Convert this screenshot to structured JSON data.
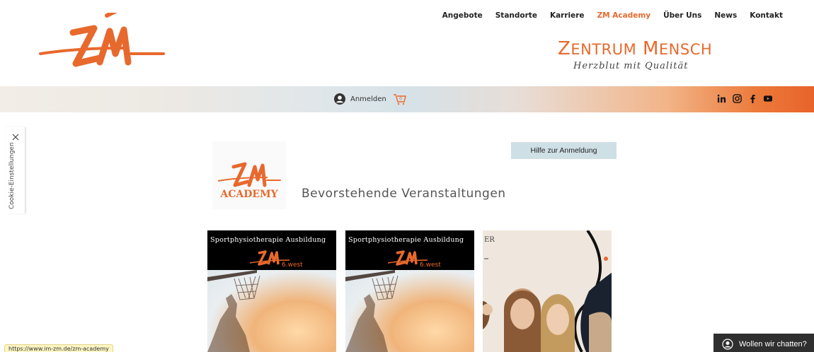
{
  "nav": {
    "items": [
      {
        "label": "Angebote"
      },
      {
        "label": "Standorte"
      },
      {
        "label": "Karriere"
      },
      {
        "label": "ZM Academy",
        "active": true
      },
      {
        "label": "Über Uns"
      },
      {
        "label": "News"
      },
      {
        "label": "Kontakt"
      }
    ]
  },
  "brand": {
    "name_first": "Z",
    "name_first_rest": "ENTRUM",
    "name_second": "M",
    "name_second_rest": "ENSCH",
    "tagline": "Herzblut mit Qualität",
    "accent": "#e8692d"
  },
  "band": {
    "login_label": "Anmelden",
    "cart_count": "0",
    "social_icons": [
      "linkedin-icon",
      "instagram-icon",
      "facebook-icon",
      "youtube-icon"
    ]
  },
  "cookie": {
    "label": "Cookie-Einstellungen"
  },
  "main": {
    "academy_logo_text": "ACADEMY",
    "events_title": "Bevorstehende Veranstaltungen",
    "help_button": "Hilfe zur Anmeldung",
    "cards": [
      {
        "title": "Sportphysiotherapie Ausbildung",
        "logo_sub": "6.west"
      },
      {
        "title": "Sportphysiotherapie Ausbildung",
        "logo_sub": "6.west"
      },
      {
        "title": "",
        "logo_sub": ""
      }
    ]
  },
  "status": {
    "url": "https://www.im-zm.de/zm-academy"
  },
  "chat": {
    "label": "Wollen wir chatten?"
  }
}
